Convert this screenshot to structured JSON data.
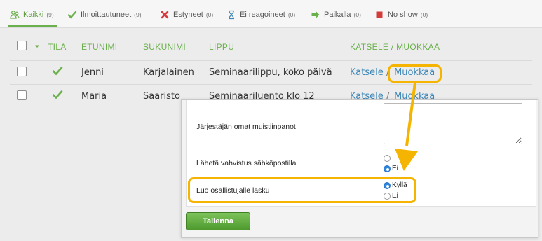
{
  "tabs": [
    {
      "label": "Kaikki",
      "count": "(9)",
      "icon": "people-icon",
      "active": true
    },
    {
      "label": "Ilmoittautuneet",
      "count": "(9)",
      "icon": "checkmark-icon",
      "active": false
    },
    {
      "label": "Estyneet",
      "count": "(0)",
      "icon": "cross-icon",
      "active": false
    },
    {
      "label": "Ei reagoineet",
      "count": "(0)",
      "icon": "hourglass-icon",
      "active": false
    },
    {
      "label": "Paikalla",
      "count": "(0)",
      "icon": "arrow-right-icon",
      "active": false
    },
    {
      "label": "No show",
      "count": "(0)",
      "icon": "square-stop-icon",
      "active": false
    }
  ],
  "table": {
    "headers": {
      "status": "TILA",
      "firstname": "ETUNIMI",
      "lastname": "SUKUNIMI",
      "ticket": "LIPPU",
      "actions": "KATSELE / MUOKKAA"
    },
    "rows": [
      {
        "firstname": "Jenni",
        "lastname": "Karjalainen",
        "ticket": "Seminaarilippu, koko päivä",
        "view": "Katsele",
        "sep": "/",
        "edit": "Muokkaa"
      },
      {
        "firstname": "Maria",
        "lastname": "Saaristo",
        "ticket": "Seminaariluento klo 12",
        "view": "Katsele",
        "sep": "/",
        "edit": "Muokkaa"
      }
    ]
  },
  "form": {
    "notes_label": "Järjestäjän omat muistiinpanot",
    "notes_value": "",
    "confirm_label": "Lähetä vahvistus sähköpostilla",
    "confirm_options": [
      "",
      "Ei"
    ],
    "confirm_selected": "Ei",
    "invoice_label": "Luo osallistujalle lasku",
    "invoice_options": [
      "Kyllä",
      "Ei"
    ],
    "invoice_selected": "Kyllä",
    "save_label": "Tallenna"
  },
  "colors": {
    "accent_green": "#6ab04c",
    "link_blue": "#3d87b8",
    "highlight": "#f5b400",
    "error_red": "#d43c3c"
  }
}
